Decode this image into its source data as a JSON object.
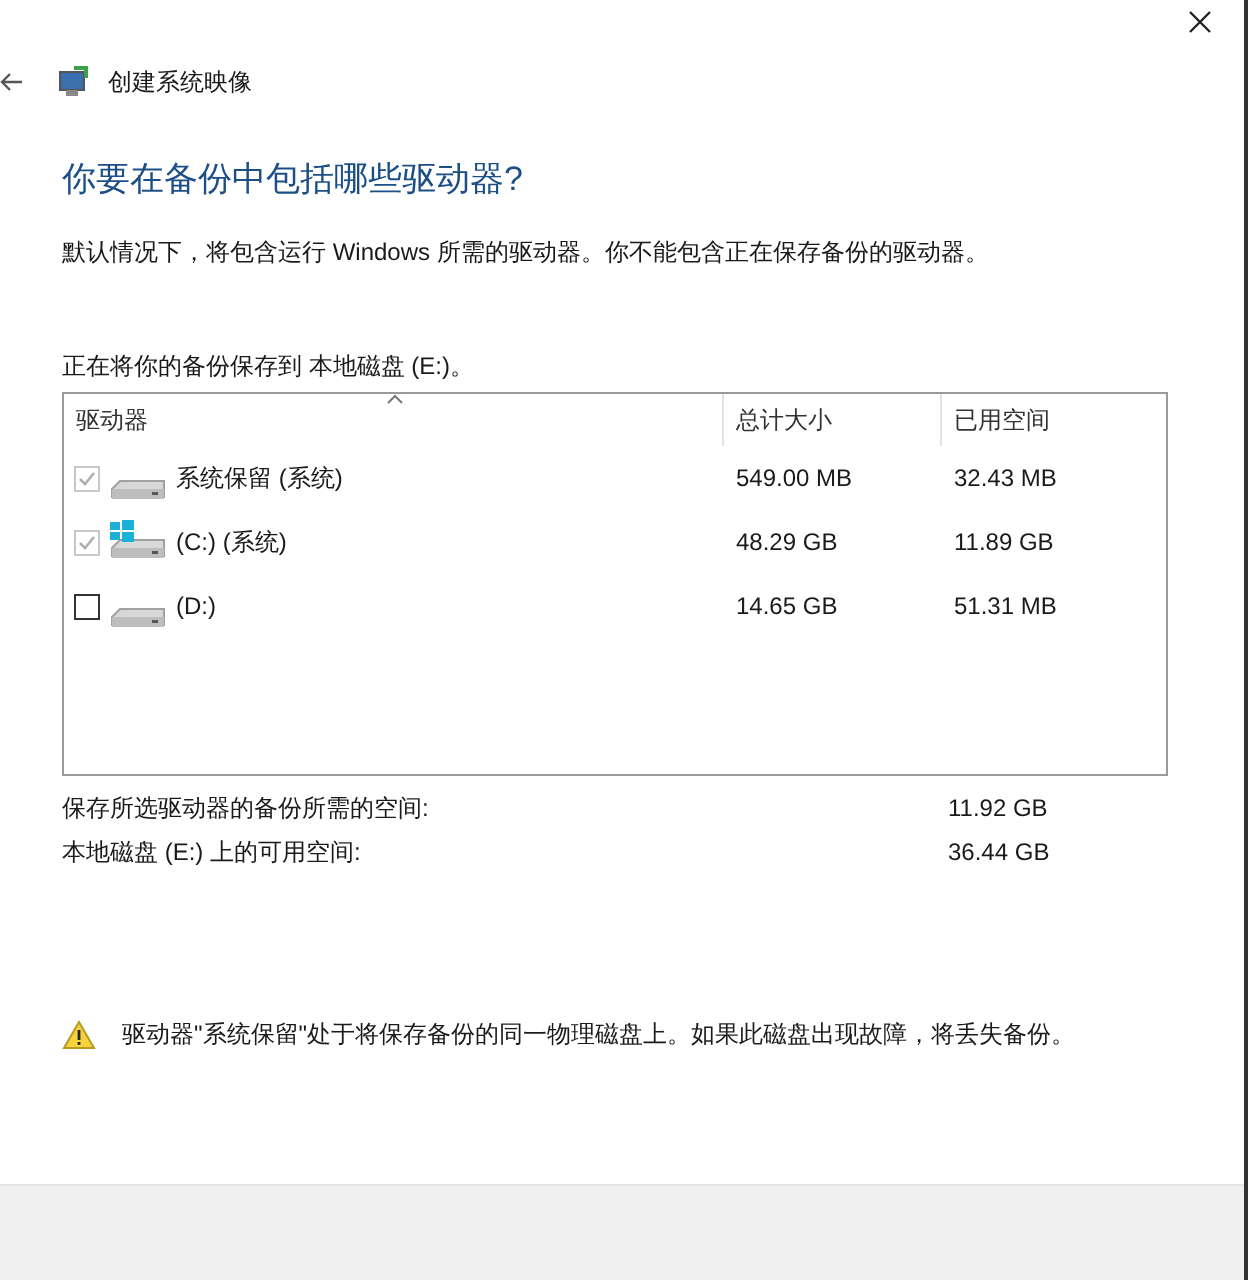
{
  "window": {
    "title": "创建系统映像"
  },
  "heading": "你要在备份中包括哪些驱动器?",
  "description": "默认情况下，将包含运行 Windows 所需的驱动器。你不能包含正在保存备份的驱动器。",
  "save_location": "正在将你的备份保存到 本地磁盘 (E:)。",
  "table": {
    "columns": [
      "驱动器",
      "总计大小",
      "已用空间"
    ],
    "rows": [
      {
        "kind": "disk",
        "name": "系统保留 (系统)",
        "size": "549.00 MB",
        "used": "32.43 MB",
        "checked": true,
        "disabled": true
      },
      {
        "kind": "windows",
        "name": "(C:) (系统)",
        "size": "48.29 GB",
        "used": "11.89 GB",
        "checked": true,
        "disabled": true
      },
      {
        "kind": "disk",
        "name": "(D:)",
        "size": "14.65 GB",
        "used": "51.31 MB",
        "checked": false,
        "disabled": false
      }
    ]
  },
  "summary": [
    {
      "label": "保存所选驱动器的备份所需的空间:",
      "value": "11.92 GB"
    },
    {
      "label": "本地磁盘 (E:) 上的可用空间:",
      "value": "36.44 GB"
    }
  ],
  "warning": "驱动器\"系统保留\"处于将保存备份的同一物理磁盘上。如果此磁盘出现故障，将丢失备份。"
}
